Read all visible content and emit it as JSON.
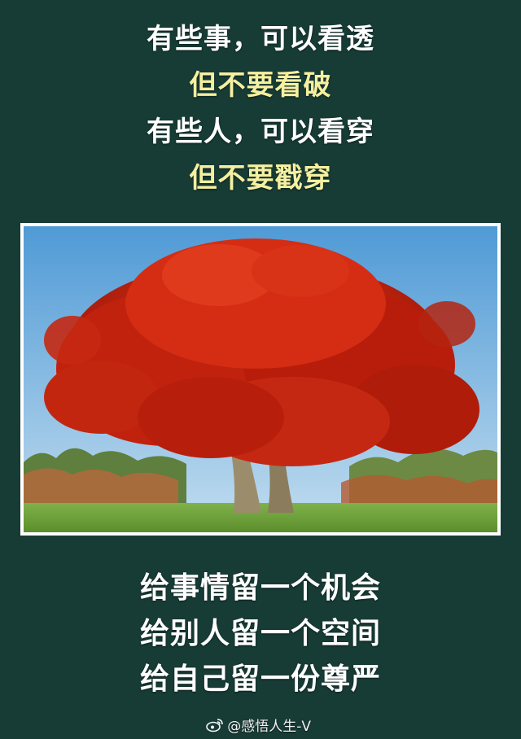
{
  "top_lines": [
    {
      "text": "有些事，可以看透",
      "color": "#ffffff"
    },
    {
      "text": "但不要看破",
      "color": "#f5f0a0"
    },
    {
      "text": "有些人，可以看穿",
      "color": "#ffffff"
    },
    {
      "text": "但不要戳穿",
      "color": "#f5f0a0"
    }
  ],
  "bottom_lines": [
    "给事情留一个机会",
    "给别人留一个空间",
    "给自己留一份尊严"
  ],
  "photo": {
    "subject": "red-autumn-tree",
    "colors": {
      "sky_top": "#5aa3d8",
      "sky_bottom": "#b9d9ef",
      "foliage": "#c8230f",
      "grass": "#6fa43a",
      "trunk": "#8c7e62"
    }
  },
  "watermark": {
    "icon": "weibo-icon",
    "text": "@感悟人生-V"
  },
  "colors": {
    "background": "#173b35",
    "highlight_text": "#f5f0a0",
    "text": "#ffffff"
  }
}
